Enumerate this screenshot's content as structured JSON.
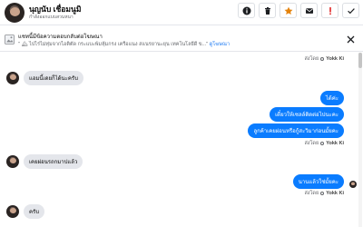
{
  "header": {
    "name": "นุญนับ เชื่อมนูมิ",
    "status": "กำลังออกแบบสวนหนา",
    "actions": [
      {
        "icon": "info-icon",
        "color": "#1c1e21"
      },
      {
        "icon": "trash-icon",
        "color": "#1c1e21"
      },
      {
        "icon": "star-icon",
        "color": "#e4820a"
      },
      {
        "icon": "mail-icon",
        "color": "#1c1e21"
      },
      {
        "icon": "alert-icon",
        "color": "#e02424"
      },
      {
        "icon": "check-icon",
        "color": "#1c1e21"
      }
    ]
  },
  "notice": {
    "title": "แชทนี้มีข้อความตอบกลับต่อโฆษณา",
    "body": "\" 🏔 ไปไร่ไม่ทุ่มจากไอติตัด กระแบะพ้มหุ้มกรง เครือแนง สแนรยานะยุน เทคโนโลยีดี ข...\"",
    "link": "ดูโฆษณา"
  },
  "messages": [
    {
      "kind": "timestamp",
      "sender": "Yokk Ki",
      "time": "ส่งโดย"
    },
    {
      "kind": "in",
      "text": "แอมนี้เดยก็ได้นะครับ"
    },
    {
      "kind": "out",
      "text": "ได้ค่ะ"
    },
    {
      "kind": "out",
      "text": "เดี๋ยวให้เซลล์ติดต่อไปนะคะ"
    },
    {
      "kind": "out",
      "text": "ลูกค้าเคยผ่อนหรือกู้สะวิมาก่อนมั้ยคะ"
    },
    {
      "kind": "timestamp",
      "sender": "Yokk Ki",
      "time": "ส่งโดย"
    },
    {
      "kind": "in",
      "text": "เคยผ่อนรถกมาปแล้ว"
    },
    {
      "kind": "out",
      "text": "นานแล้วใช่มั้ยคะ"
    },
    {
      "kind": "timestamp",
      "sender": "Yokk Ki",
      "time": "ส่งโดย"
    },
    {
      "kind": "in",
      "text": "ครับ"
    }
  ],
  "colors": {
    "accent": "#0a7cff",
    "incoming_bubble": "#e4e6eb",
    "text_muted": "#65676b",
    "link": "#1877f2"
  }
}
